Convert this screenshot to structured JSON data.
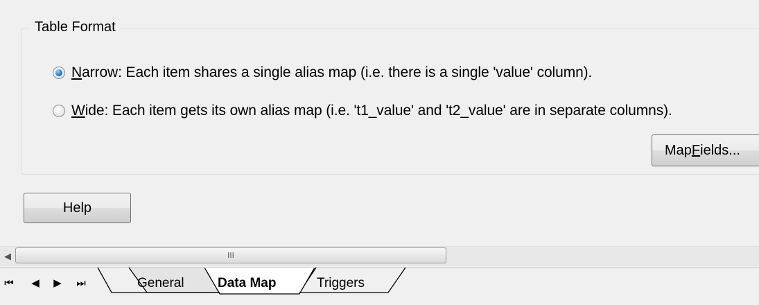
{
  "group": {
    "title": "Table Format"
  },
  "options": [
    {
      "accel": "N",
      "rest": "arrow: Each item shares a single alias map (i.e. there is a single 'value' column).",
      "checked": true
    },
    {
      "accel": "W",
      "rest": "ide: Each item gets its own alias map (i.e. 't1_value' and 't2_value' are in separate columns).",
      "checked": false
    }
  ],
  "buttons": {
    "map_fields_pre": "Map ",
    "map_fields_accel": "F",
    "map_fields_post": "ields...",
    "help": "Help"
  },
  "scrollbar": {
    "grip": "III"
  },
  "nav": {
    "first": "⏮",
    "prev": "◀",
    "next": "▶",
    "last": "⏭"
  },
  "tabs": [
    {
      "label": "General",
      "active": false
    },
    {
      "label": "Data Map",
      "active": true
    },
    {
      "label": "Triggers",
      "active": false
    }
  ]
}
